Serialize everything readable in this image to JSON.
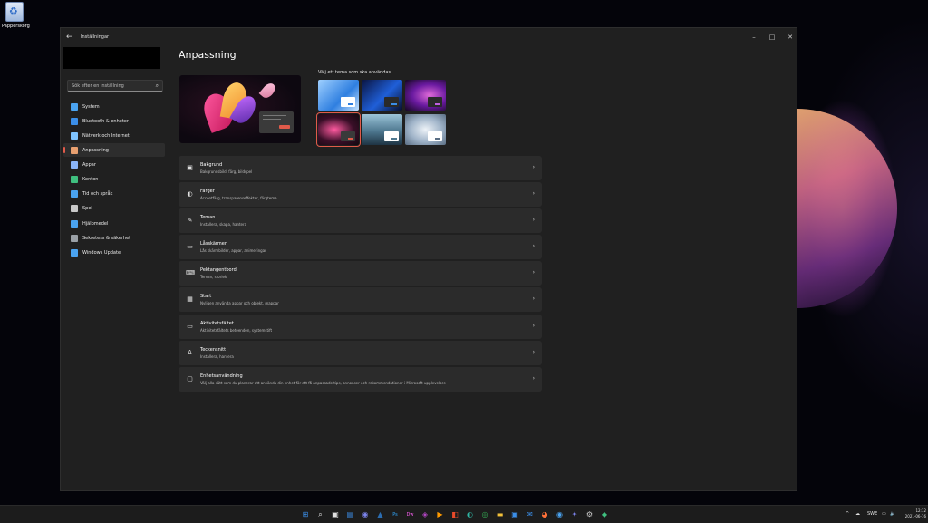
{
  "desktop": {
    "recycle_bin_label": "Papperskorg"
  },
  "window": {
    "title": "Inställningar",
    "controls": {
      "minimize": "–",
      "maximize": "□",
      "close": "✕"
    }
  },
  "search": {
    "placeholder": "Sök efter en inställning"
  },
  "sidebar": {
    "items": [
      {
        "label": "System",
        "icon": "monitor-icon",
        "color": "#4aa3f0",
        "active": false
      },
      {
        "label": "Bluetooth & enheter",
        "icon": "bluetooth-icon",
        "color": "#3b8ee8",
        "active": false
      },
      {
        "label": "Nätverk och Internet",
        "icon": "wifi-icon",
        "color": "#7fc4ff",
        "active": false
      },
      {
        "label": "Anpassning",
        "icon": "brush-icon",
        "color": "#e8a070",
        "active": true
      },
      {
        "label": "Appar",
        "icon": "apps-icon",
        "color": "#8ab4f8",
        "active": false
      },
      {
        "label": "Konton",
        "icon": "account-icon",
        "color": "#3fbf7f",
        "active": false
      },
      {
        "label": "Tid och språk",
        "icon": "globe-clock-icon",
        "color": "#4aa3f0",
        "active": false
      },
      {
        "label": "Spel",
        "icon": "gamepad-icon",
        "color": "#c8c8c8",
        "active": false
      },
      {
        "label": "Hjälpmedel",
        "icon": "accessibility-icon",
        "color": "#4aa3f0",
        "active": false
      },
      {
        "label": "Sekretess & säkerhet",
        "icon": "shield-icon",
        "color": "#9aa0a6",
        "active": false
      },
      {
        "label": "Windows Update",
        "icon": "update-icon",
        "color": "#4aa3f0",
        "active": false
      }
    ]
  },
  "main": {
    "title": "Anpassning",
    "theme_label": "Välj ett tema som ska användas",
    "themes": [
      {
        "name": "theme-windows-light",
        "bg": "linear-gradient(135deg,#9fd0ff,#2f7fe0 60%,#c8e4ff)",
        "mini": "#ffffff",
        "btn": "#2f7fe0",
        "selected": false
      },
      {
        "name": "theme-windows-dark",
        "bg": "linear-gradient(135deg,#0a1440,#1f5fd8 55%,#0a0f2a)",
        "mini": "#2a2a2a",
        "btn": "#3b8ee8",
        "selected": false
      },
      {
        "name": "theme-glow",
        "bg": "radial-gradient(ellipse at 60% 50%,#e06ad8,#6a1aa0 50%,#140820)",
        "mini": "#2a2a2a",
        "btn": "#c060e0",
        "selected": false
      },
      {
        "name": "theme-captured-motion",
        "bg": "radial-gradient(ellipse at 40% 50%,#ff5aa0,#3a0f28 55%,#120810)",
        "mini": "#3a3a3a",
        "btn": "#e05a4a",
        "selected": true
      },
      {
        "name": "theme-sunrise",
        "bg": "linear-gradient(180deg,#9cc4d8,#4e7890 55%,#1e3444)",
        "mini": "#ffffff",
        "btn": "#4e7890",
        "selected": false
      },
      {
        "name": "theme-flow",
        "bg": "radial-gradient(ellipse at 50% 50%,#eef3f8,#9fb3c8 55%,#5a6e84)",
        "mini": "#ffffff",
        "btn": "#5a6e84",
        "selected": false
      }
    ],
    "settings": [
      {
        "title": "Bakgrund",
        "sub": "Bakgrundsbild, färg, bildspel",
        "icon": "image-icon",
        "glyph": "▣"
      },
      {
        "title": "Färger",
        "sub": "Accentfärg, transparenseffekter, färgtema",
        "icon": "palette-icon",
        "glyph": "◐"
      },
      {
        "title": "Teman",
        "sub": "Installera, skapa, hantera",
        "icon": "pen-icon",
        "glyph": "✎"
      },
      {
        "title": "Låsskärmen",
        "sub": "Lås skärmbilder, appar, animeringar",
        "icon": "lockscreen-icon",
        "glyph": "▭"
      },
      {
        "title": "Pektangentbord",
        "sub": "Teman, storlek",
        "icon": "keyboard-icon",
        "glyph": "⌨"
      },
      {
        "title": "Start",
        "sub": "Nyligen använda appar och objekt, mappar",
        "icon": "start-icon",
        "glyph": "▦"
      },
      {
        "title": "Aktivitetsfältet",
        "sub": "Aktivitetsfältets beteenden, systemstift",
        "icon": "taskbar-icon",
        "glyph": "▭"
      },
      {
        "title": "Teckensnitt",
        "sub": "Installera, hantera",
        "icon": "font-icon",
        "glyph": "A"
      },
      {
        "title": "Enhetsanvändning",
        "sub": "Välj alla sätt som du planerar att använda din enhet för att få anpassade tips, annonser och rekommendationer i Microsoft-upplevelser.",
        "icon": "device-usage-icon",
        "glyph": "▢"
      }
    ]
  },
  "taskbar": {
    "icons": [
      {
        "name": "start-icon",
        "glyph": "⊞",
        "color": "#3b8ee8"
      },
      {
        "name": "search-icon",
        "glyph": "⌕",
        "color": "#e0e0e0"
      },
      {
        "name": "task-view-icon",
        "glyph": "▣",
        "color": "#e0e0e0"
      },
      {
        "name": "widgets-icon",
        "glyph": "▤",
        "color": "#3b8ee8"
      },
      {
        "name": "chat-icon",
        "glyph": "◉",
        "color": "#7b83eb"
      },
      {
        "name": "app-icon-1",
        "glyph": "▲",
        "color": "#2b6cb0"
      },
      {
        "name": "photoshop-icon",
        "glyph": "Ps",
        "color": "#31a8ff"
      },
      {
        "name": "dreamweaver-icon",
        "glyph": "Dw",
        "color": "#ff61f6"
      },
      {
        "name": "app-icon-2",
        "glyph": "◈",
        "color": "#b146c2"
      },
      {
        "name": "app-icon-3",
        "glyph": "▶",
        "color": "#ff9a00"
      },
      {
        "name": "office-icon",
        "glyph": "◧",
        "color": "#e84a2a"
      },
      {
        "name": "edge-icon",
        "glyph": "◐",
        "color": "#2fb5a3"
      },
      {
        "name": "chrome-icon",
        "glyph": "◎",
        "color": "#34a853"
      },
      {
        "name": "file-explorer-icon",
        "glyph": "▬",
        "color": "#f3c13a"
      },
      {
        "name": "store-icon",
        "glyph": "▣",
        "color": "#3b8ee8"
      },
      {
        "name": "mail-icon",
        "glyph": "✉",
        "color": "#3b8ee8"
      },
      {
        "name": "firefox-icon",
        "glyph": "◕",
        "color": "#ff7139"
      },
      {
        "name": "app-icon-4",
        "glyph": "◉",
        "color": "#4aa3f0"
      },
      {
        "name": "teams-icon",
        "glyph": "✦",
        "color": "#7b83eb"
      },
      {
        "name": "settings-icon",
        "glyph": "⚙",
        "color": "#c8c8c8"
      },
      {
        "name": "app-icon-5",
        "glyph": "◆",
        "color": "#3fbf7f"
      }
    ],
    "tray": {
      "chevron": "^",
      "weather": "☁",
      "lang": "SWE",
      "network": "▭",
      "volume": "🔈"
    },
    "time": "12:12",
    "date": "2021-06-16"
  }
}
